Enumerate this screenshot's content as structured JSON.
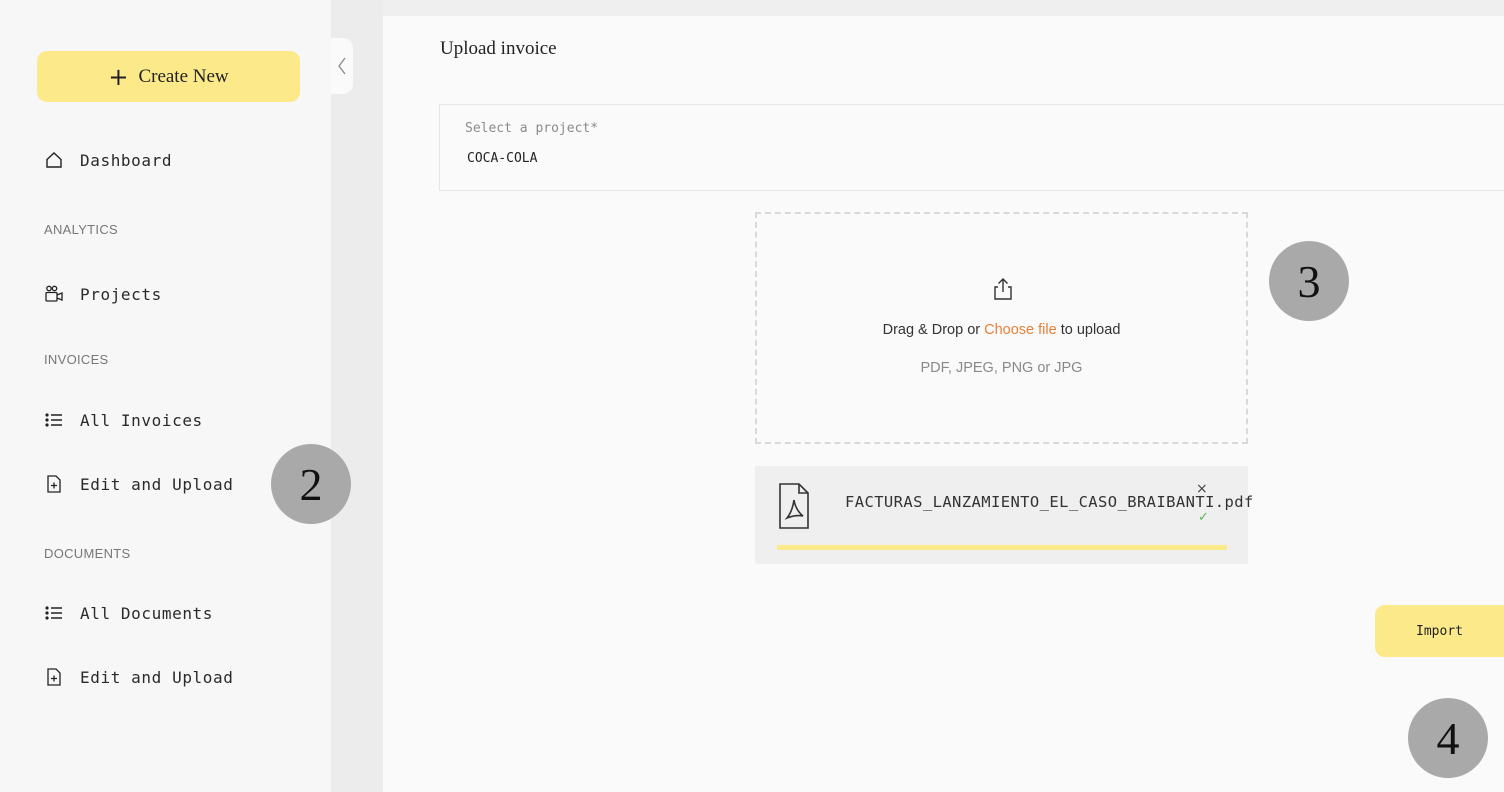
{
  "sidebar": {
    "create_new": {
      "icon": "plus-icon",
      "label": "Create New"
    },
    "dashboard": {
      "icon": "home-icon",
      "label": "Dashboard"
    },
    "sections": {
      "analytics": "ANALYTICS",
      "invoices": "INVOICES",
      "documents": "DOCUMENTS"
    },
    "items": [
      {
        "icon": "camera-icon",
        "label": "Projects"
      },
      {
        "icon": "list-icon",
        "label": "All Invoices"
      },
      {
        "icon": "file-plus-icon",
        "label": "Edit and Upload"
      },
      {
        "icon": "list-icon",
        "label": "All Documents"
      },
      {
        "icon": "file-plus-icon",
        "label": "Edit and Upload"
      }
    ]
  },
  "collapse": {
    "icon": "chevron-left-icon"
  },
  "main": {
    "title": "Upload invoice",
    "project_select": {
      "label": "Select a project*",
      "value": "COCA-COLA"
    },
    "dropzone": {
      "icon": "upload-icon",
      "text_before": "Drag & Drop or ",
      "link": "Choose file",
      "text_after": " to upload",
      "hint": "PDF, JPEG, PNG or JPG"
    },
    "file": {
      "icon": "pdf-file-icon",
      "name": "FACTURAS_LANZAMIENTO_EL_CASO_BRAIBANTI.pdf",
      "remove_icon": "close-icon",
      "remove": "×",
      "status_icon": "check-icon",
      "status": "✓",
      "progress": 1.0
    },
    "import_button": "Import"
  },
  "markers": [
    "2",
    "3",
    "4"
  ],
  "colors": {
    "accent": "#fbe98a",
    "link": "#e8803a",
    "success": "#5ab75a",
    "marker": "#a9a9a9"
  }
}
